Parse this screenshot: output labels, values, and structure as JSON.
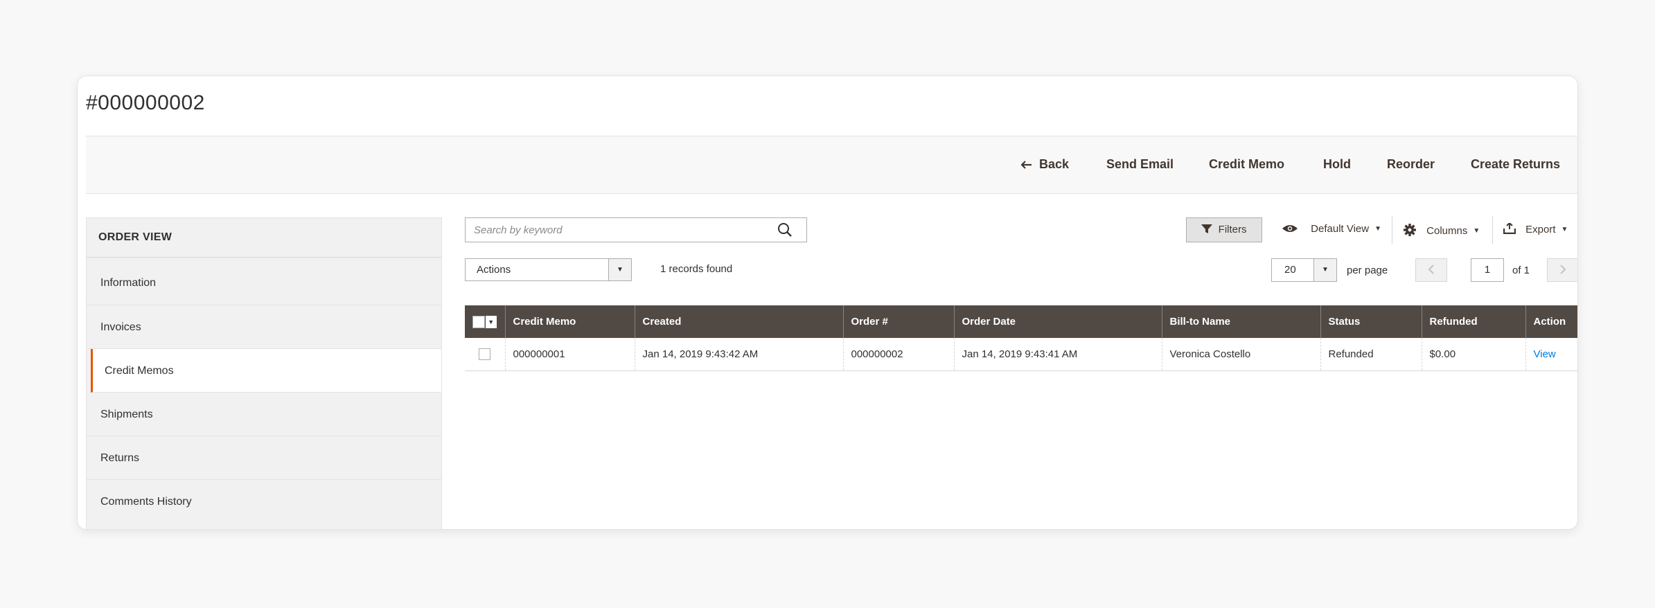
{
  "page": {
    "title": "#000000002"
  },
  "action_bar": {
    "back": "Back",
    "send_email": "Send Email",
    "credit_memo": "Credit Memo",
    "hold": "Hold",
    "reorder": "Reorder",
    "create_returns": "Create Returns"
  },
  "sidebar": {
    "title": "ORDER VIEW",
    "items": [
      {
        "label": "Information"
      },
      {
        "label": "Invoices"
      },
      {
        "label": "Credit Memos"
      },
      {
        "label": "Shipments"
      },
      {
        "label": "Returns"
      },
      {
        "label": "Comments History"
      }
    ],
    "active_item": "Credit Memos"
  },
  "grid": {
    "search_placeholder": "Search by keyword",
    "filters_label": "Filters",
    "default_view_label": "Default View",
    "columns_label": "Columns",
    "export_label": "Export",
    "actions_label": "Actions",
    "records_found": "1 records found",
    "per_page_value": "20",
    "per_page_label": "per page",
    "current_page": "1",
    "page_of": "of 1",
    "columns": [
      "Credit Memo",
      "Created",
      "Order #",
      "Order Date",
      "Bill-to Name",
      "Status",
      "Refunded",
      "Action"
    ],
    "rows": [
      {
        "credit_memo": "000000001",
        "created": "Jan 14, 2019 9:43:42 AM",
        "order_number": "000000002",
        "order_date": "Jan 14, 2019 9:43:41 AM",
        "bill_to_name": "Veronica Costello",
        "status": "Refunded",
        "refunded": "$0.00",
        "action": "View"
      }
    ]
  },
  "colors": {
    "accent": "#eb5202",
    "table_header": "#514943",
    "link": "#007bdb"
  }
}
